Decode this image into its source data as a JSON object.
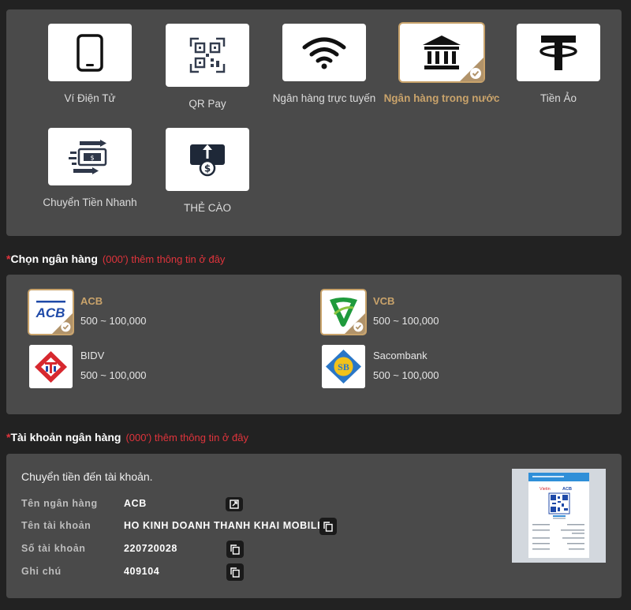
{
  "methods": [
    {
      "label": "Ví Điện Tử",
      "icon": "phone-icon",
      "selected": false
    },
    {
      "label": "QR Pay",
      "icon": "qr-icon",
      "selected": false
    },
    {
      "label": "Ngân hàng trực tuyến",
      "icon": "wifi-icon",
      "selected": false
    },
    {
      "label": "Ngân hàng trong nước",
      "icon": "bank-icon",
      "selected": true
    },
    {
      "label": "Tiền Ảo",
      "icon": "tether-icon",
      "selected": false
    },
    {
      "label": "Chuyển Tiền Nhanh",
      "icon": "fast-transfer-icon",
      "selected": false
    },
    {
      "label": "THẺ CÀO",
      "icon": "card-topup-icon",
      "selected": false
    }
  ],
  "bank_section": {
    "star": "*",
    "title": "Chọn ngân hàng",
    "hint": "(000') thêm thông tin ở đây"
  },
  "banks": [
    {
      "name": "ACB",
      "range": "500 ~ 100,000",
      "selected": true
    },
    {
      "name": "VCB",
      "range": "500 ~ 100,000",
      "selected": true
    },
    {
      "name": "BIDV",
      "range": "500 ~ 100,000",
      "selected": false
    },
    {
      "name": "Sacombank",
      "range": "500 ~ 100,000",
      "selected": false
    }
  ],
  "account_section": {
    "star": "*",
    "title": "Tài khoản ngân hàng",
    "hint": "(000') thêm thông tin ở đây"
  },
  "account": {
    "heading": "Chuyển tiền đến tài khoản.",
    "rows": [
      {
        "key": "Tên ngân hàng",
        "value": "ACB"
      },
      {
        "key": "Tên tài khoản",
        "value": "HO KINH DOANH THANH KHAI MOBILE"
      },
      {
        "key": "Số tài khoản",
        "value": "220720028"
      },
      {
        "key": "Ghi chú",
        "value": "409104"
      }
    ],
    "qr_card": {
      "brand_left": "Vietin",
      "brand_right": "ACB"
    }
  },
  "colors": {
    "accent": "#c9a36b",
    "required": "#e0343c",
    "panel": "#4a4a4a",
    "background": "#222222"
  }
}
